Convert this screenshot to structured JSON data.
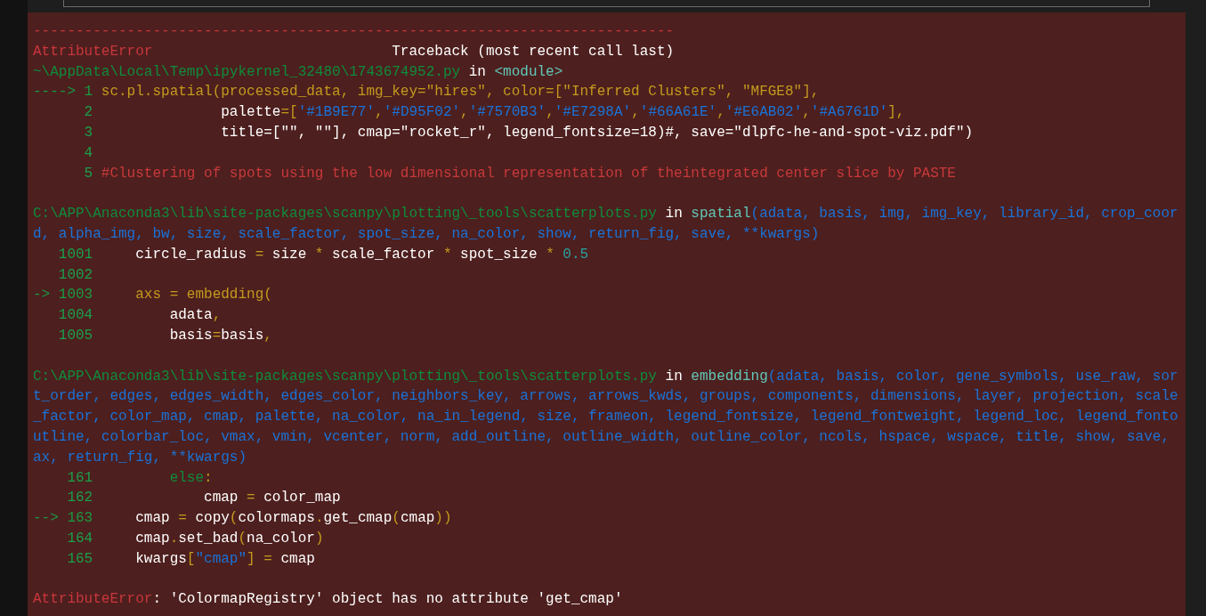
{
  "sections": [
    {
      "lines": [
        [
          {
            "text": "---------------------------------------------------------------------------",
            "kind": "error"
          }
        ],
        [
          {
            "text": "AttributeError",
            "kind": "error"
          },
          {
            "text": "                            Traceback (most recent call last)",
            "kind": "plain"
          }
        ],
        [
          {
            "text": "~\\AppData\\Local\\Temp\\ipykernel_32480\\1743674952.py",
            "kind": "path"
          },
          {
            "text": " in ",
            "kind": "plain"
          },
          {
            "text": "<module>",
            "kind": "func"
          }
        ],
        [
          {
            "text": "----> 1 ",
            "kind": "arrow"
          },
          {
            "text": "sc.pl.spatial(processed_data, img_key=\"hires\", color=[\"Inferred Clusters\", \"MFGE8\"],",
            "kind": "punct"
          }
        ],
        [
          {
            "text": "      2 ",
            "kind": "lineno"
          },
          {
            "text": "              palette",
            "kind": "plain"
          },
          {
            "text": "=[",
            "kind": "punct"
          },
          {
            "text": "'#1B9E77'",
            "kind": "str"
          },
          {
            "text": ",",
            "kind": "punct"
          },
          {
            "text": "'#D95F02'",
            "kind": "str"
          },
          {
            "text": ",",
            "kind": "punct"
          },
          {
            "text": "'#7570B3'",
            "kind": "str"
          },
          {
            "text": ",",
            "kind": "punct"
          },
          {
            "text": "'#E7298A'",
            "kind": "str"
          },
          {
            "text": ",",
            "kind": "punct"
          },
          {
            "text": "'#66A61E'",
            "kind": "str"
          },
          {
            "text": ",",
            "kind": "punct"
          },
          {
            "text": "'#E6AB02'",
            "kind": "str"
          },
          {
            "text": ",",
            "kind": "punct"
          },
          {
            "text": "'#A6761D'",
            "kind": "str"
          },
          {
            "text": "],",
            "kind": "punct"
          }
        ],
        [
          {
            "text": "      3 ",
            "kind": "lineno"
          },
          {
            "text": "              title=[\"\", \"\"], cmap=\"rocket_r\", legend_fontsize=18)#, save=\"dlpfc-he-and-spot-viz.pdf\")",
            "kind": "plain"
          }
        ],
        [
          {
            "text": "      4",
            "kind": "lineno"
          }
        ],
        [
          {
            "text": "      5 ",
            "kind": "lineno"
          },
          {
            "text": "#Clustering of spots using the low dimensional representation of theintegrated center slice by PASTE",
            "kind": "comment"
          }
        ]
      ]
    },
    {
      "lines": [
        [
          {
            "text": "C:\\APP\\Anaconda3\\lib\\site-packages\\scanpy\\plotting\\_tools\\scatterplots.py",
            "kind": "path"
          },
          {
            "text": " in ",
            "kind": "plain"
          },
          {
            "text": "spatial",
            "kind": "func"
          },
          {
            "text": "(adata, basis, img, img_key, library_id, crop_coor",
            "kind": "str"
          }
        ],
        [
          {
            "text": "d, alpha_img, bw, size, scale_factor, spot_size, na_color, show, return_fig, save, **kwargs)",
            "kind": "str"
          }
        ],
        [
          {
            "text": "   1001 ",
            "kind": "lineno"
          },
          {
            "text": "    circle_radius ",
            "kind": "plain"
          },
          {
            "text": "=",
            "kind": "punct"
          },
          {
            "text": " size ",
            "kind": "plain"
          },
          {
            "text": "*",
            "kind": "punct"
          },
          {
            "text": " scale_factor ",
            "kind": "plain"
          },
          {
            "text": "*",
            "kind": "punct"
          },
          {
            "text": " spot_size ",
            "kind": "plain"
          },
          {
            "text": "*",
            "kind": "punct"
          },
          {
            "text": " 0.5",
            "kind": "num"
          }
        ],
        [
          {
            "text": "   1002",
            "kind": "lineno"
          }
        ],
        [
          {
            "text": "-> 1003 ",
            "kind": "arrow"
          },
          {
            "text": "    axs = embedding(",
            "kind": "punct"
          }
        ],
        [
          {
            "text": "   1004 ",
            "kind": "lineno"
          },
          {
            "text": "        adata",
            "kind": "plain"
          },
          {
            "text": ",",
            "kind": "punct"
          }
        ],
        [
          {
            "text": "   1005 ",
            "kind": "lineno"
          },
          {
            "text": "        basis",
            "kind": "plain"
          },
          {
            "text": "=",
            "kind": "punct"
          },
          {
            "text": "basis",
            "kind": "plain"
          },
          {
            "text": ",",
            "kind": "punct"
          }
        ]
      ]
    },
    {
      "lines": [
        [
          {
            "text": "C:\\APP\\Anaconda3\\lib\\site-packages\\scanpy\\plotting\\_tools\\scatterplots.py",
            "kind": "path"
          },
          {
            "text": " in ",
            "kind": "plain"
          },
          {
            "text": "embedding",
            "kind": "func"
          },
          {
            "text": "(adata, basis, color, gene_symbols, use_raw, sor",
            "kind": "str"
          }
        ],
        [
          {
            "text": "t_order, edges, edges_width, edges_color, neighbors_key, arrows, arrows_kwds, groups, components, dimensions, layer, projection, scale",
            "kind": "str"
          }
        ],
        [
          {
            "text": "_factor, color_map, cmap, palette, na_color, na_in_legend, size, frameon, legend_fontsize, legend_fontweight, legend_loc, legend_fonto",
            "kind": "str"
          }
        ],
        [
          {
            "text": "utline, colorbar_loc, vmax, vmin, vcenter, norm, add_outline, outline_width, outline_color, ncols, hspace, wspace, title, show, save,",
            "kind": "str"
          }
        ],
        [
          {
            "text": "ax, return_fig, **kwargs)",
            "kind": "str"
          }
        ],
        [
          {
            "text": "    161 ",
            "kind": "lineno"
          },
          {
            "text": "        else",
            "kind": "keyword"
          },
          {
            "text": ":",
            "kind": "punct"
          }
        ],
        [
          {
            "text": "    162 ",
            "kind": "lineno"
          },
          {
            "text": "            cmap ",
            "kind": "plain"
          },
          {
            "text": "=",
            "kind": "punct"
          },
          {
            "text": " color_map",
            "kind": "plain"
          }
        ],
        [
          {
            "text": "--> 163 ",
            "kind": "arrow"
          },
          {
            "text": "    cmap ",
            "kind": "plain"
          },
          {
            "text": "=",
            "kind": "punct"
          },
          {
            "text": " copy",
            "kind": "plain"
          },
          {
            "text": "(",
            "kind": "punct"
          },
          {
            "text": "colormaps",
            "kind": "plain"
          },
          {
            "text": ".",
            "kind": "punct"
          },
          {
            "text": "get_cmap",
            "kind": "plain"
          },
          {
            "text": "(",
            "kind": "punct"
          },
          {
            "text": "cmap",
            "kind": "plain"
          },
          {
            "text": "))",
            "kind": "punct"
          }
        ],
        [
          {
            "text": "    164 ",
            "kind": "lineno"
          },
          {
            "text": "    cmap",
            "kind": "plain"
          },
          {
            "text": ".",
            "kind": "punct"
          },
          {
            "text": "set_bad",
            "kind": "plain"
          },
          {
            "text": "(",
            "kind": "punct"
          },
          {
            "text": "na_color",
            "kind": "plain"
          },
          {
            "text": ")",
            "kind": "punct"
          }
        ],
        [
          {
            "text": "    165 ",
            "kind": "lineno"
          },
          {
            "text": "    kwargs",
            "kind": "plain"
          },
          {
            "text": "[",
            "kind": "punct"
          },
          {
            "text": "\"cmap\"",
            "kind": "str"
          },
          {
            "text": "] =",
            "kind": "punct"
          },
          {
            "text": " cmap",
            "kind": "plain"
          }
        ]
      ]
    },
    {
      "lines": [
        [
          {
            "text": "AttributeError",
            "kind": "error"
          },
          {
            "text": ": 'ColormapRegistry' object has no attribute 'get_cmap'",
            "kind": "plain"
          }
        ]
      ]
    }
  ]
}
